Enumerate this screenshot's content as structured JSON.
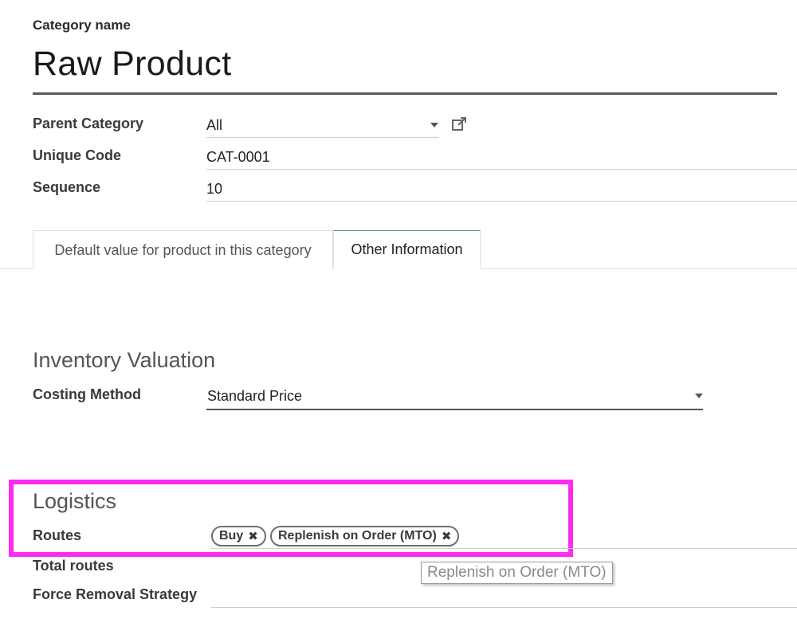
{
  "header": {
    "category_name_label": "Category name",
    "category_name_value": "Raw Product"
  },
  "fields": {
    "parent_category_label": "Parent Category",
    "parent_category_value": "All",
    "unique_code_label": "Unique Code",
    "unique_code_value": "CAT-0001",
    "sequence_label": "Sequence",
    "sequence_value": "10"
  },
  "tabs": [
    {
      "label": "Default value for product in this category",
      "active": false
    },
    {
      "label": "Other Information",
      "active": true
    }
  ],
  "inventory": {
    "section_title": "Inventory Valuation",
    "costing_method_label": "Costing Method",
    "costing_method_value": "Standard Price"
  },
  "logistics": {
    "section_title": "Logistics",
    "routes_label": "Routes",
    "routes_tags": [
      "Buy",
      "Replenish on Order (MTO)"
    ],
    "total_routes_label": "Total routes",
    "force_removal_label": "Force Removal Strategy"
  },
  "tooltip": {
    "text": "Replenish on Order (MTO)"
  },
  "icons": {
    "external_link": "external-link-icon",
    "dropdown": "chevron-down-icon",
    "tag_remove": "close-icon"
  },
  "colors": {
    "highlight": "#ff2bf1",
    "active_tab_top": "#2f9c9c"
  }
}
